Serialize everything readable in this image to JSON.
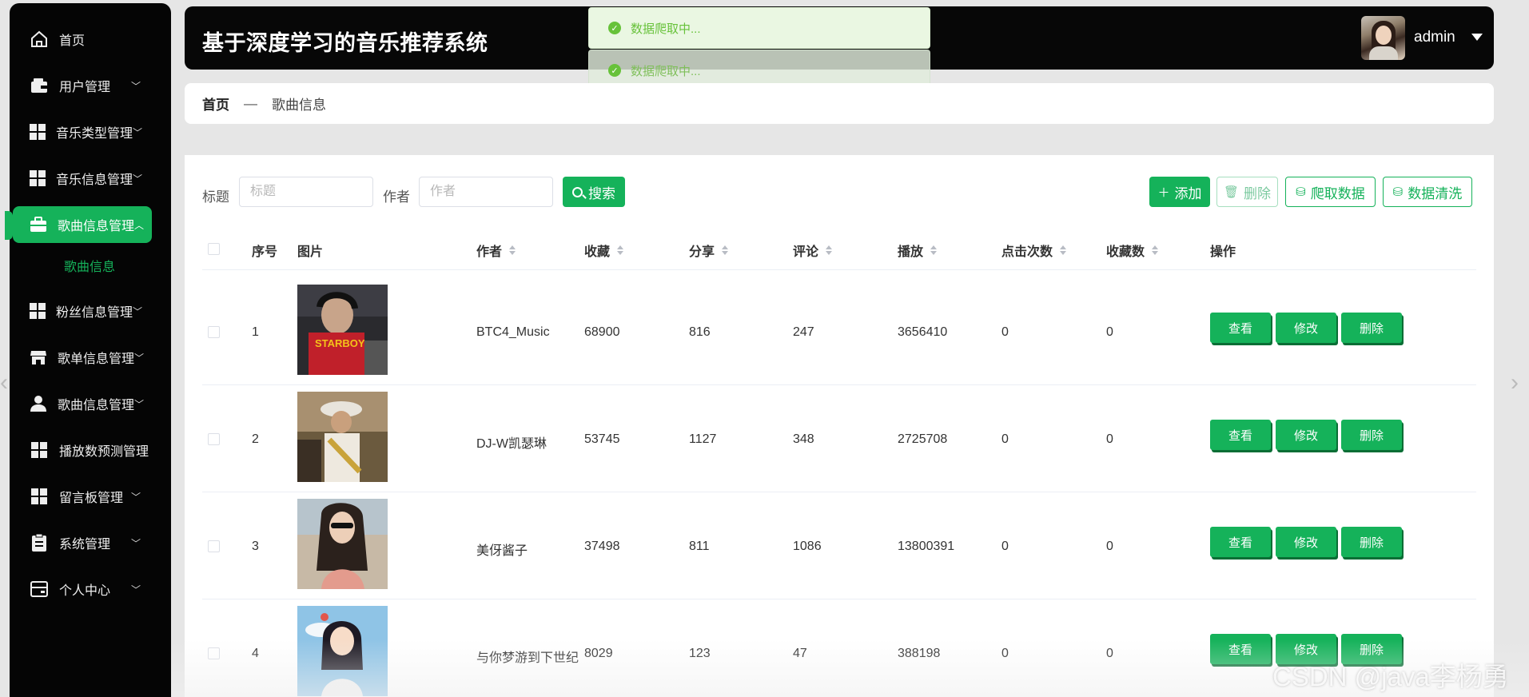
{
  "sidebar": {
    "items": [
      {
        "label": "首页",
        "icon": "home-icon",
        "has_children": false
      },
      {
        "label": "用户管理",
        "icon": "wallet-icon",
        "has_children": true
      },
      {
        "label": "音乐类型管理",
        "icon": "grid-icon",
        "has_children": true
      },
      {
        "label": "音乐信息管理",
        "icon": "grid-icon",
        "has_children": true
      },
      {
        "label": "歌曲信息管理",
        "icon": "briefcase-icon",
        "has_children": true,
        "active": true
      },
      {
        "label": "粉丝信息管理",
        "icon": "grid-icon",
        "has_children": true
      },
      {
        "label": "歌单信息管理",
        "icon": "store-icon",
        "has_children": true
      },
      {
        "label": "歌曲信息管理",
        "icon": "user-icon",
        "has_children": true
      },
      {
        "label": "播放数预测管理",
        "icon": "grid-icon",
        "has_children": true
      },
      {
        "label": "留言板管理",
        "icon": "grid-icon",
        "has_children": true
      },
      {
        "label": "系统管理",
        "icon": "clipboard-icon",
        "has_children": true
      },
      {
        "label": "个人中心",
        "icon": "card-icon",
        "has_children": true
      }
    ],
    "sub_item": "歌曲信息"
  },
  "header": {
    "title": "基于深度学习的音乐推荐系统",
    "username": "admin"
  },
  "toasts": [
    "数据爬取中...",
    "数据爬取中..."
  ],
  "breadcrumb": {
    "home": "首页",
    "separator": "—",
    "current": "歌曲信息"
  },
  "search": {
    "title_label": "标题",
    "title_placeholder": "标题",
    "author_label": "作者",
    "author_placeholder": "作者",
    "button": "搜索"
  },
  "toolbar": {
    "add": "添加",
    "delete": "删除",
    "crawl": "爬取数据",
    "clean": "数据清洗"
  },
  "table": {
    "columns": [
      "序号",
      "图片",
      "作者",
      "收藏",
      "分享",
      "评论",
      "播放",
      "点击次数",
      "收藏数",
      "操作"
    ],
    "rows": [
      {
        "index": "1",
        "author": "BTC4_Music",
        "favorites": "68900",
        "shares": "816",
        "comments": "247",
        "plays": "3656410",
        "clicks": "0",
        "fav_count": "0"
      },
      {
        "index": "2",
        "author": "DJ-W凯瑟琳",
        "favorites": "53745",
        "shares": "1127",
        "comments": "348",
        "plays": "2725708",
        "clicks": "0",
        "fav_count": "0"
      },
      {
        "index": "3",
        "author": "美伢酱子",
        "favorites": "37498",
        "shares": "811",
        "comments": "1086",
        "plays": "13800391",
        "clicks": "0",
        "fav_count": "0"
      },
      {
        "index": "4",
        "author": "与你梦游到下世纪",
        "favorites": "8029",
        "shares": "123",
        "comments": "47",
        "plays": "388198",
        "clicks": "0",
        "fav_count": "0"
      }
    ],
    "row_actions": {
      "view": "查看",
      "edit": "修改",
      "delete": "删除"
    }
  },
  "watermark": "CSDN @java李杨勇",
  "colors": {
    "accent": "#15b25a",
    "sidebar_bg": "#050505",
    "toast_text": "#67c23a"
  }
}
